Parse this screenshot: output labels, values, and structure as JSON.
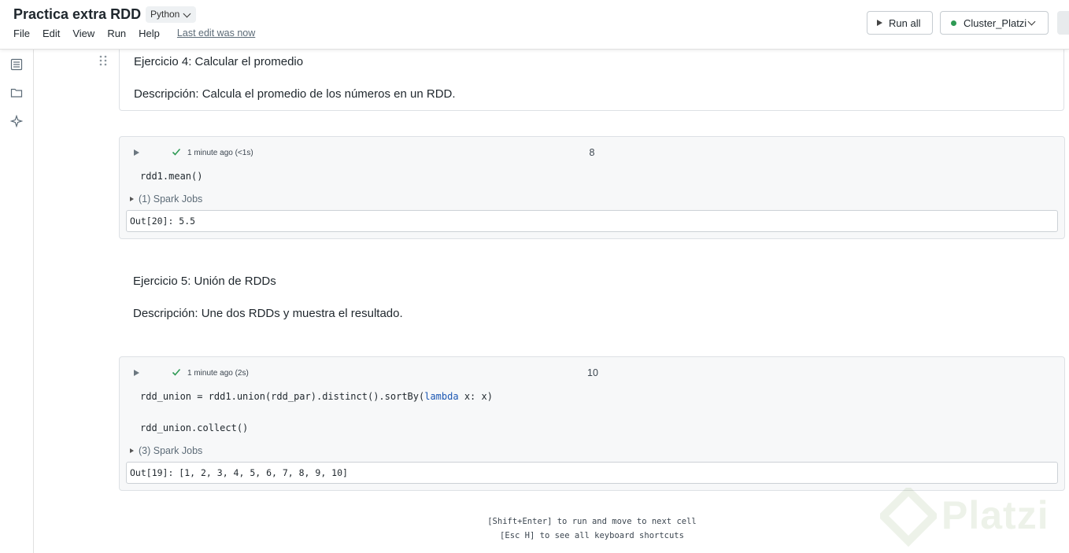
{
  "header": {
    "title": "Practica extra RDD",
    "language": "Python",
    "menu": [
      "File",
      "Edit",
      "View",
      "Run",
      "Help"
    ],
    "last_edit": "Last edit was now",
    "run_all": "Run all",
    "cluster": "Cluster_Platzi",
    "cluster_status_color": "#2e9a54"
  },
  "rail_icons": [
    "table-of-contents-icon",
    "folder-icon",
    "assistant-sparkle-icon"
  ],
  "cells": {
    "md1": {
      "title": "Ejercicio 4: Calcular el promedio",
      "description": "Descripción: Calcula el promedio de los números en un RDD."
    },
    "code1": {
      "status": "1 minute ago (<1s)",
      "number": "8",
      "code": "rdd1.mean()",
      "jobs": "(1) Spark Jobs",
      "output": "Out[20]: 5.5"
    },
    "md2": {
      "title": "Ejercicio 5: Unión de RDDs",
      "description": "Descripción: Une dos RDDs y muestra el resultado."
    },
    "code2": {
      "status": "1 minute ago (2s)",
      "number": "10",
      "code_line1_pre": "rdd_union = rdd1.union(rdd_par).distinct().sortBy(",
      "code_line1_kw": "lambda",
      "code_line1_post": " x: x)",
      "code_line2": "rdd_union.collect()",
      "jobs": "(3) Spark Jobs",
      "output": "Out[19]: [1, 2, 3, 4, 5, 6, 7, 8, 9, 10]"
    }
  },
  "hints": {
    "line1": "[Shift+Enter] to run and move to next cell",
    "line2": "[Esc H] to see all keyboard shortcuts"
  },
  "watermark": "Platzi"
}
